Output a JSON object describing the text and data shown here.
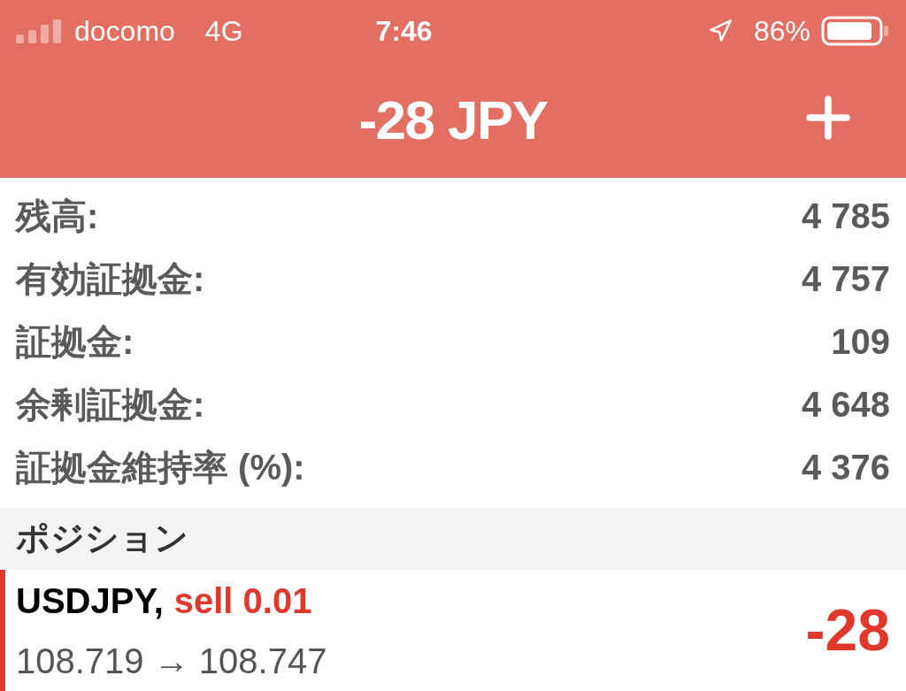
{
  "status_bar": {
    "carrier": "docomo",
    "network": "4G",
    "time": "7:46",
    "battery": "86%"
  },
  "header": {
    "title": "-28 JPY"
  },
  "account": [
    {
      "label": "残高:",
      "value": "4 785"
    },
    {
      "label": "有効証拠金:",
      "value": "4 757"
    },
    {
      "label": "証拠金:",
      "value": "109"
    },
    {
      "label": "余剰証拠金:",
      "value": "4 648"
    },
    {
      "label": "証拠金維持率 (%):",
      "value": "4 376"
    }
  ],
  "section": {
    "title": "ポジション"
  },
  "positions": [
    {
      "symbol": "USDJPY,",
      "kind": "sell",
      "side": "sell 0.01",
      "prices": "108.719 → 108.747",
      "profit": "-28"
    }
  ]
}
